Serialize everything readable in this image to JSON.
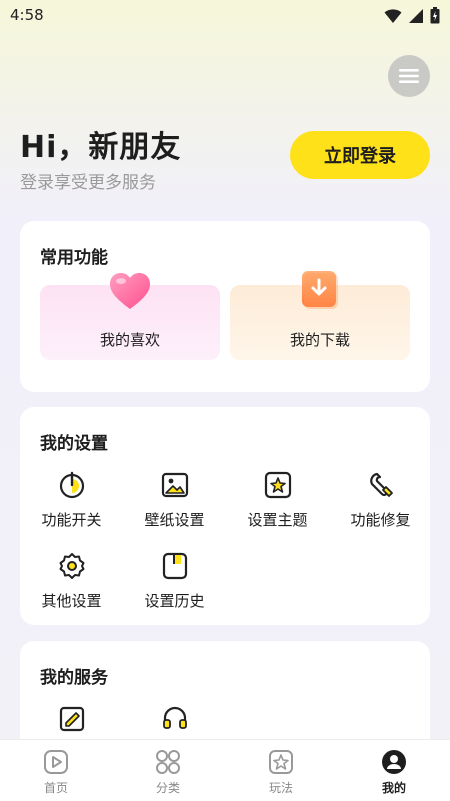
{
  "status_bar": {
    "time": "4:58"
  },
  "header": {
    "greeting": "Hi，新朋友",
    "subtitle": "登录享受更多服务",
    "login_button": "立即登录"
  },
  "common_features": {
    "title": "常用功能",
    "items": [
      {
        "label": "我的喜欢",
        "icon": "heart-icon"
      },
      {
        "label": "我的下载",
        "icon": "download-icon"
      }
    ]
  },
  "my_settings": {
    "title": "我的设置",
    "items": [
      {
        "label": "功能开关",
        "icon": "power-icon"
      },
      {
        "label": "壁纸设置",
        "icon": "wallpaper-icon"
      },
      {
        "label": "设置主题",
        "icon": "theme-icon"
      },
      {
        "label": "功能修复",
        "icon": "wrench-icon"
      },
      {
        "label": "其他设置",
        "icon": "gear-icon"
      },
      {
        "label": "设置历史",
        "icon": "history-icon"
      }
    ]
  },
  "my_services": {
    "title": "我的服务",
    "items": [
      {
        "icon": "feedback-icon"
      },
      {
        "icon": "headset-icon"
      }
    ]
  },
  "tab_bar": {
    "active": "我的",
    "tabs": [
      {
        "label": "首页",
        "icon": "play-icon"
      },
      {
        "label": "分类",
        "icon": "grid-icon"
      },
      {
        "label": "玩法",
        "icon": "sparkle-icon"
      },
      {
        "label": "我的",
        "icon": "profile-icon"
      }
    ]
  },
  "colors": {
    "accent": "#ffe11a",
    "background": "#f2f1f8",
    "text": "#1e1e1e"
  }
}
